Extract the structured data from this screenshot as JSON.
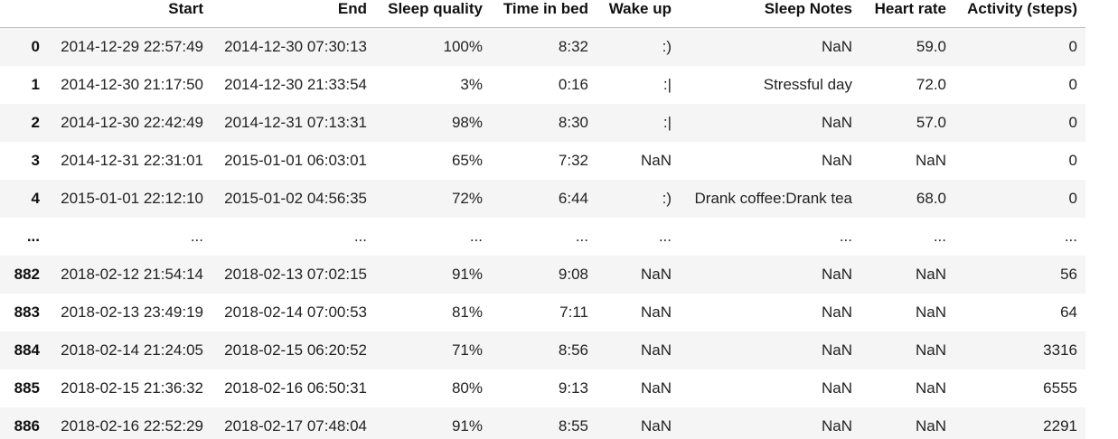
{
  "columns": {
    "index": "",
    "start": "Start",
    "end": "End",
    "sleep_quality": "Sleep quality",
    "time_in_bed": "Time in bed",
    "wake_up": "Wake up",
    "sleep_notes": "Sleep Notes",
    "heart_rate": "Heart rate",
    "activity": "Activity (steps)"
  },
  "rows": [
    {
      "idx": "0",
      "start": "2014-12-29 22:57:49",
      "end": "2014-12-30 07:30:13",
      "sleep_quality": "100%",
      "time_in_bed": "8:32",
      "wake_up": ":)",
      "sleep_notes": "NaN",
      "heart_rate": "59.0",
      "activity": "0"
    },
    {
      "idx": "1",
      "start": "2014-12-30 21:17:50",
      "end": "2014-12-30 21:33:54",
      "sleep_quality": "3%",
      "time_in_bed": "0:16",
      "wake_up": ":|",
      "sleep_notes": "Stressful day",
      "heart_rate": "72.0",
      "activity": "0"
    },
    {
      "idx": "2",
      "start": "2014-12-30 22:42:49",
      "end": "2014-12-31 07:13:31",
      "sleep_quality": "98%",
      "time_in_bed": "8:30",
      "wake_up": ":|",
      "sleep_notes": "NaN",
      "heart_rate": "57.0",
      "activity": "0"
    },
    {
      "idx": "3",
      "start": "2014-12-31 22:31:01",
      "end": "2015-01-01 06:03:01",
      "sleep_quality": "65%",
      "time_in_bed": "7:32",
      "wake_up": "NaN",
      "sleep_notes": "NaN",
      "heart_rate": "NaN",
      "activity": "0"
    },
    {
      "idx": "4",
      "start": "2015-01-01 22:12:10",
      "end": "2015-01-02 04:56:35",
      "sleep_quality": "72%",
      "time_in_bed": "6:44",
      "wake_up": ":)",
      "sleep_notes": "Drank coffee:Drank tea",
      "heart_rate": "68.0",
      "activity": "0"
    },
    {
      "idx": "...",
      "start": "...",
      "end": "...",
      "sleep_quality": "...",
      "time_in_bed": "...",
      "wake_up": "...",
      "sleep_notes": "...",
      "heart_rate": "...",
      "activity": "..."
    },
    {
      "idx": "882",
      "start": "2018-02-12 21:54:14",
      "end": "2018-02-13 07:02:15",
      "sleep_quality": "91%",
      "time_in_bed": "9:08",
      "wake_up": "NaN",
      "sleep_notes": "NaN",
      "heart_rate": "NaN",
      "activity": "56"
    },
    {
      "idx": "883",
      "start": "2018-02-13 23:49:19",
      "end": "2018-02-14 07:00:53",
      "sleep_quality": "81%",
      "time_in_bed": "7:11",
      "wake_up": "NaN",
      "sleep_notes": "NaN",
      "heart_rate": "NaN",
      "activity": "64"
    },
    {
      "idx": "884",
      "start": "2018-02-14 21:24:05",
      "end": "2018-02-15 06:20:52",
      "sleep_quality": "71%",
      "time_in_bed": "8:56",
      "wake_up": "NaN",
      "sleep_notes": "NaN",
      "heart_rate": "NaN",
      "activity": "3316"
    },
    {
      "idx": "885",
      "start": "2018-02-15 21:36:32",
      "end": "2018-02-16 06:50:31",
      "sleep_quality": "80%",
      "time_in_bed": "9:13",
      "wake_up": "NaN",
      "sleep_notes": "NaN",
      "heart_rate": "NaN",
      "activity": "6555"
    },
    {
      "idx": "886",
      "start": "2018-02-16 22:52:29",
      "end": "2018-02-17 07:48:04",
      "sleep_quality": "91%",
      "time_in_bed": "8:55",
      "wake_up": "NaN",
      "sleep_notes": "NaN",
      "heart_rate": "NaN",
      "activity": "2291"
    }
  ]
}
